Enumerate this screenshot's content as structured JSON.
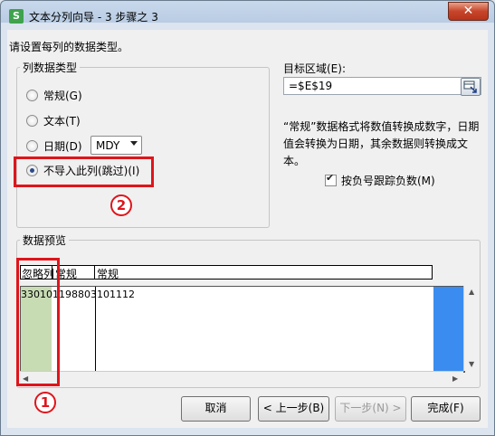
{
  "window": {
    "title": "文本分列向导 - 3 步骤之 3",
    "app_icon": "S",
    "close_symbol": "✕"
  },
  "instruction": "请设置每列的数据类型。",
  "column_type": {
    "group_title": "列数据类型",
    "options": [
      {
        "label": "常规(G)",
        "checked": false
      },
      {
        "label": "文本(T)",
        "checked": false
      },
      {
        "label": "日期(D)",
        "checked": false
      },
      {
        "label": "不导入此列(跳过)(I)",
        "checked": true
      }
    ],
    "date_format": "MDY"
  },
  "destination": {
    "label": "目标区域(E):",
    "value": "=$E$19",
    "picker_icon": "range-select-icon"
  },
  "description": "“常规”数据格式将数值转换成数字，日期值会转换为日期，其余数据则转换成文本。",
  "negative_option": {
    "label": "按负号跟踪负数(M)",
    "checked": true
  },
  "preview": {
    "group_title": "数据预览",
    "headers": [
      "忽略列",
      "常规",
      "常规"
    ],
    "row": "330101198803101112"
  },
  "annotations": {
    "badge_1": "1",
    "badge_2": "2",
    "color": "#e0141b"
  },
  "buttons": {
    "cancel": "取消",
    "back": "< 上一步(B)",
    "next": "下一步(N) >",
    "finish": "完成(F)"
  }
}
